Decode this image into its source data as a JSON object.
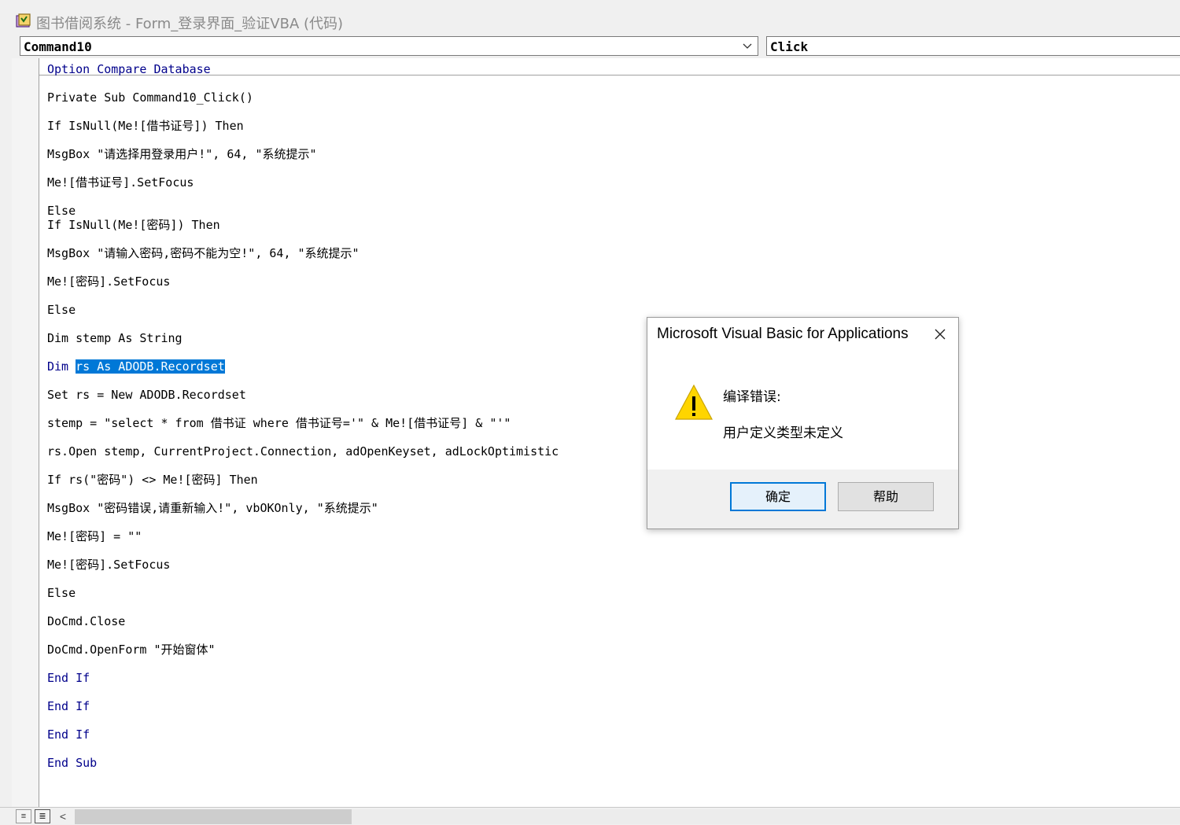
{
  "window": {
    "title": "图书借阅系统 - Form_登录界面_验证VBA (代码)"
  },
  "toolbar": {
    "object_combo": "Command10",
    "procedure_combo": "Click"
  },
  "code": {
    "lines": [
      "Option Compare Database",
      "Private Sub Command10_Click()",
      "If IsNull(Me![借书证号]) Then",
      "MsgBox \"请选择用登录用户!\", 64, \"系统提示\"",
      "Me![借书证号].SetFocus",
      "Else",
      "If IsNull(Me![密码]) Then",
      "MsgBox \"请输入密码,密码不能为空!\", 64, \"系统提示\"",
      "Me![密码].SetFocus",
      "Else",
      "Dim stemp As String",
      "Dim rs As ADODB.Recordset",
      "Set rs = New ADODB.Recordset",
      "stemp = \"select * from 借书证 where 借书证号='\" & Me![借书证号] & \"'\"",
      "rs.Open stemp, CurrentProject.Connection, adOpenKeyset, adLockOptimistic",
      "If rs(\"密码\") <> Me![密码] Then",
      "MsgBox \"密码错误,请重新输入!\", vbOKOnly, \"系统提示\"",
      "Me![密码] = \"\"",
      "Me![密码].SetFocus",
      "Else",
      "DoCmd.Close",
      "DoCmd.OpenForm \"开始窗体\"",
      "End If",
      "End If",
      "End If",
      "End Sub"
    ],
    "selected_text": "rs As ADODB.Recordset"
  },
  "dialog": {
    "title": "Microsoft Visual Basic for Applications",
    "heading": "编译错误:",
    "message": "用户定义类型未定义",
    "ok_label": "确定",
    "help_label": "帮助",
    "icon": "warning-icon"
  },
  "colors": {
    "keyword": "#00008b",
    "selection": "#0078d7",
    "default_button_border": "#0078d7"
  }
}
